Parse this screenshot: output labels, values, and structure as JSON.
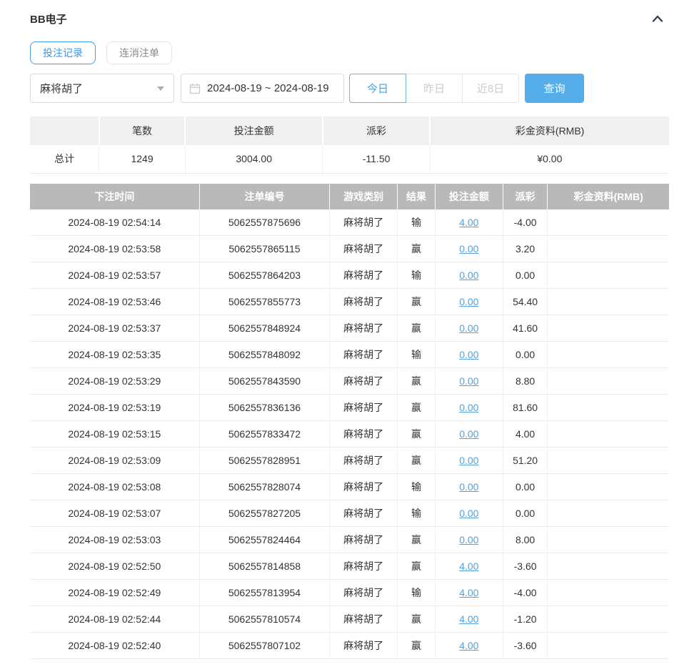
{
  "header": {
    "title": "BB电子",
    "collapse_icon": "chevron-up"
  },
  "tabs": [
    {
      "label": "投注记录",
      "active": true
    },
    {
      "label": "连消注单",
      "active": false
    }
  ],
  "filters": {
    "game_select": {
      "value": "麻将胡了",
      "icon": "caret-down-icon"
    },
    "date_range": {
      "value": "2024-08-19 ~ 2024-08-19",
      "icon": "calendar-icon"
    },
    "quick_ranges": [
      {
        "label": "今日",
        "active": true
      },
      {
        "label": "昨日",
        "active": false
      },
      {
        "label": "近8日",
        "active": false
      }
    ],
    "search_label": "查询"
  },
  "summary": {
    "columns": [
      "",
      "笔数",
      "投注金额",
      "派彩",
      "彩金资料(RMB)"
    ],
    "row_label": "总计",
    "count": "1249",
    "bet_amount": "3004.00",
    "payout": "-11.50",
    "bonus": "¥0.00"
  },
  "table": {
    "columns": [
      "下注时间",
      "注单编号",
      "游戏类别",
      "结果",
      "投注金额",
      "派彩",
      "彩金资料(RMB)"
    ],
    "rows": [
      {
        "time": "2024-08-19 02:54:14",
        "order_id": "5062557875696",
        "game": "麻将胡了",
        "result": "输",
        "bet": "4.00",
        "payout": "-4.00",
        "bonus": ""
      },
      {
        "time": "2024-08-19 02:53:58",
        "order_id": "5062557865115",
        "game": "麻将胡了",
        "result": "赢",
        "bet": "0.00",
        "payout": "3.20",
        "bonus": ""
      },
      {
        "time": "2024-08-19 02:53:57",
        "order_id": "5062557864203",
        "game": "麻将胡了",
        "result": "输",
        "bet": "0.00",
        "payout": "0.00",
        "bonus": ""
      },
      {
        "time": "2024-08-19 02:53:46",
        "order_id": "5062557855773",
        "game": "麻将胡了",
        "result": "赢",
        "bet": "0.00",
        "payout": "54.40",
        "bonus": ""
      },
      {
        "time": "2024-08-19 02:53:37",
        "order_id": "5062557848924",
        "game": "麻将胡了",
        "result": "赢",
        "bet": "0.00",
        "payout": "41.60",
        "bonus": ""
      },
      {
        "time": "2024-08-19 02:53:35",
        "order_id": "5062557848092",
        "game": "麻将胡了",
        "result": "输",
        "bet": "0.00",
        "payout": "0.00",
        "bonus": ""
      },
      {
        "time": "2024-08-19 02:53:29",
        "order_id": "5062557843590",
        "game": "麻将胡了",
        "result": "赢",
        "bet": "0.00",
        "payout": "8.80",
        "bonus": ""
      },
      {
        "time": "2024-08-19 02:53:19",
        "order_id": "5062557836136",
        "game": "麻将胡了",
        "result": "赢",
        "bet": "0.00",
        "payout": "81.60",
        "bonus": ""
      },
      {
        "time": "2024-08-19 02:53:15",
        "order_id": "5062557833472",
        "game": "麻将胡了",
        "result": "赢",
        "bet": "0.00",
        "payout": "4.00",
        "bonus": ""
      },
      {
        "time": "2024-08-19 02:53:09",
        "order_id": "5062557828951",
        "game": "麻将胡了",
        "result": "赢",
        "bet": "0.00",
        "payout": "51.20",
        "bonus": ""
      },
      {
        "time": "2024-08-19 02:53:08",
        "order_id": "5062557828074",
        "game": "麻将胡了",
        "result": "输",
        "bet": "0.00",
        "payout": "0.00",
        "bonus": ""
      },
      {
        "time": "2024-08-19 02:53:07",
        "order_id": "5062557827205",
        "game": "麻将胡了",
        "result": "输",
        "bet": "0.00",
        "payout": "0.00",
        "bonus": ""
      },
      {
        "time": "2024-08-19 02:53:03",
        "order_id": "5062557824464",
        "game": "麻将胡了",
        "result": "赢",
        "bet": "0.00",
        "payout": "8.00",
        "bonus": ""
      },
      {
        "time": "2024-08-19 02:52:50",
        "order_id": "5062557814858",
        "game": "麻将胡了",
        "result": "赢",
        "bet": "4.00",
        "payout": "-3.60",
        "bonus": ""
      },
      {
        "time": "2024-08-19 02:52:49",
        "order_id": "5062557813954",
        "game": "麻将胡了",
        "result": "输",
        "bet": "4.00",
        "payout": "-4.00",
        "bonus": ""
      },
      {
        "time": "2024-08-19 02:52:44",
        "order_id": "5062557810574",
        "game": "麻将胡了",
        "result": "赢",
        "bet": "4.00",
        "payout": "-1.20",
        "bonus": ""
      },
      {
        "time": "2024-08-19 02:52:40",
        "order_id": "5062557807102",
        "game": "麻将胡了",
        "result": "赢",
        "bet": "4.00",
        "payout": "-3.60",
        "bonus": ""
      }
    ]
  },
  "colors": {
    "accent_blue": "#4aa0e6",
    "link_blue": "#54a0dc",
    "negative_red": "#f0545c",
    "table_header_gray": "#b9b9b9",
    "summary_header_gray": "#f0f0f0"
  }
}
